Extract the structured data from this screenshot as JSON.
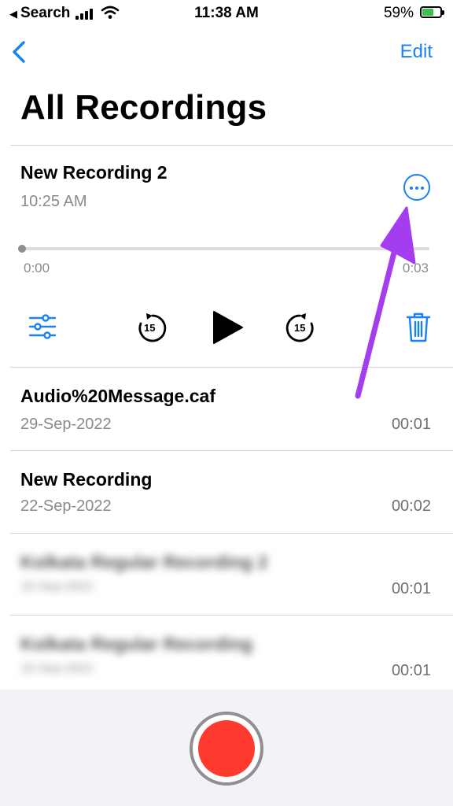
{
  "status_bar": {
    "back_app": "Search",
    "time": "11:38 AM",
    "battery": "59%"
  },
  "nav": {
    "edit_label": "Edit"
  },
  "page_title": "All Recordings",
  "expanded_recording": {
    "title": "New Recording 2",
    "time": "10:25 AM",
    "position_start": "0:00",
    "position_end": "0:03",
    "playback_progress": 0,
    "skip_back_label": "15",
    "skip_forward_label": "15"
  },
  "recordings": [
    {
      "name": "Audio%20Message.caf",
      "date": "29-Sep-2022",
      "duration": "00:01",
      "blurred": false
    },
    {
      "name": "New Recording",
      "date": "22-Sep-2022",
      "duration": "00:02",
      "blurred": false
    },
    {
      "name": "Kolkata Regular Recording 2",
      "date": "15-Sep-2022",
      "duration": "00:01",
      "blurred": true
    },
    {
      "name": "Kolkata Regular Recording",
      "date": "15-Sep-2022",
      "duration": "00:01",
      "blurred": true
    }
  ],
  "colors": {
    "accent": "#1a82f0",
    "record": "#ff3b30",
    "annotation_arrow": "#a43cf0",
    "battery": "#3bc24e"
  },
  "icons": {
    "back": "chevron-left-icon",
    "more": "ellipsis-circle-icon",
    "settings": "sliders-icon",
    "skip_back": "gobackward-15-icon",
    "play": "play-icon",
    "skip_forward": "goforward-15-icon",
    "delete": "trash-icon"
  }
}
